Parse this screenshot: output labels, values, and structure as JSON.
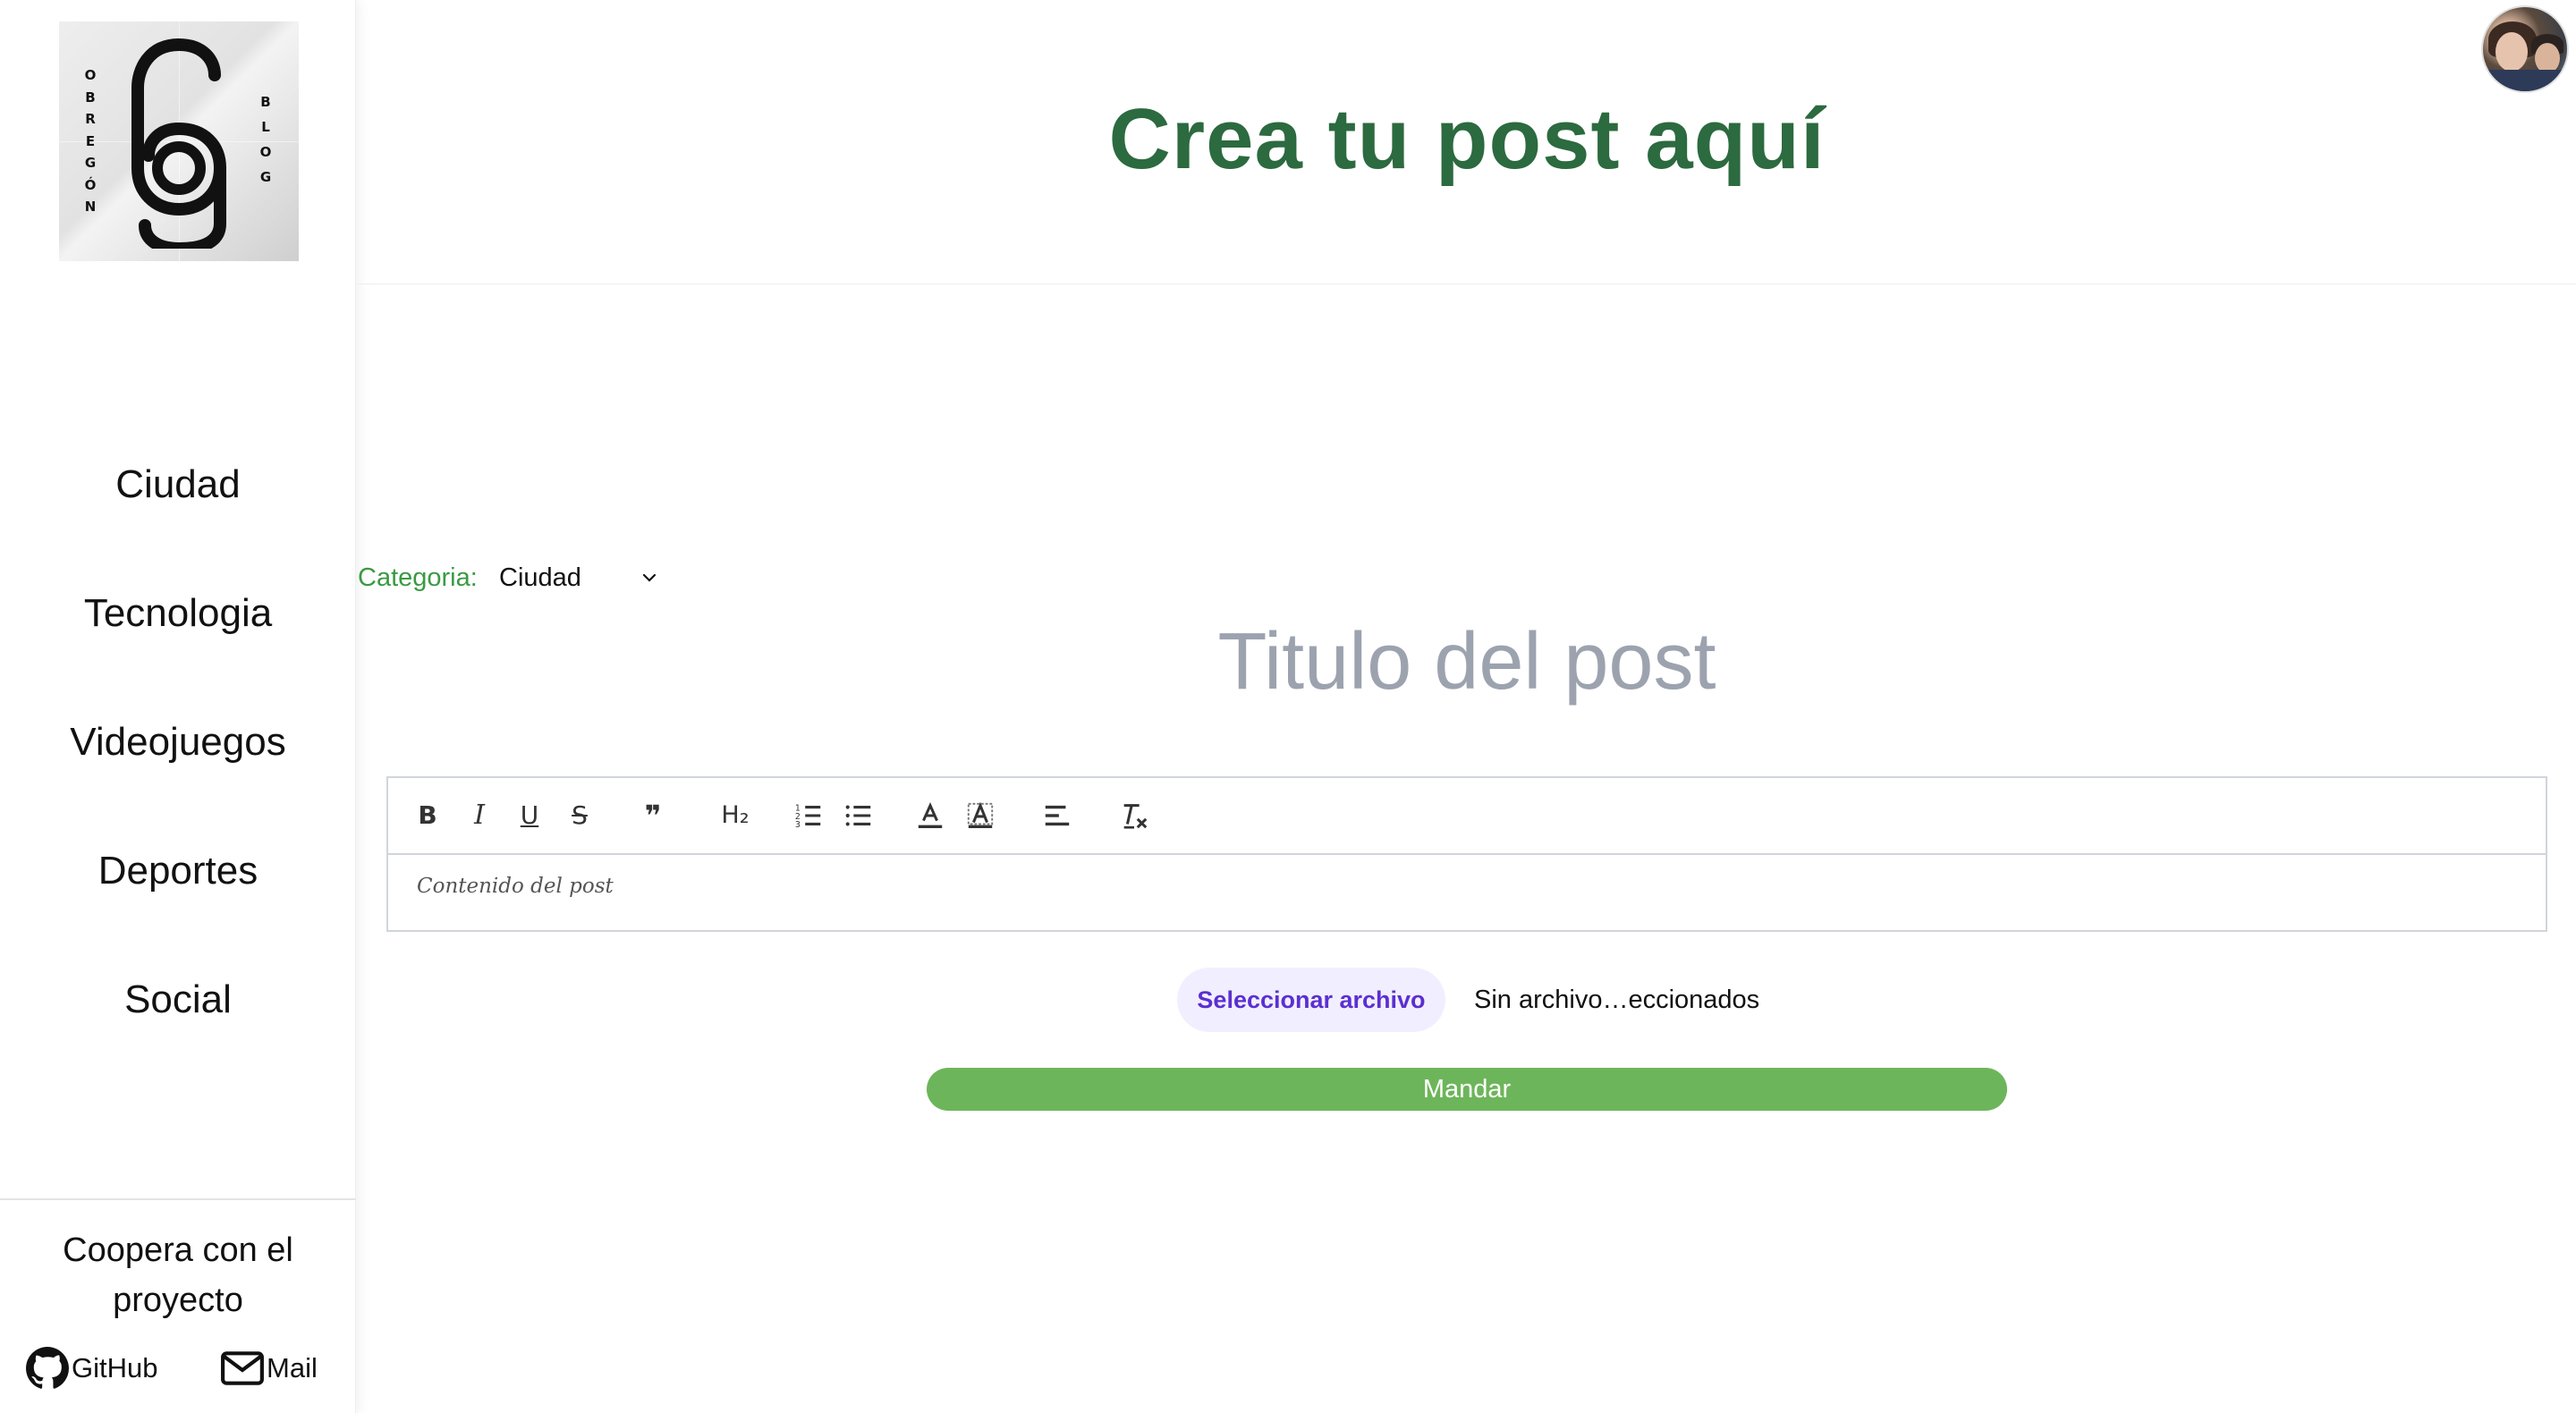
{
  "sidebar": {
    "logo": {
      "left_letters": "OBREGÓN",
      "right_letters": "BLOG"
    },
    "nav_items": [
      {
        "label": "Ciudad"
      },
      {
        "label": "Tecnologia"
      },
      {
        "label": "Videojuegos"
      },
      {
        "label": "Deportes"
      },
      {
        "label": "Social"
      }
    ],
    "cooperate_text": "Coopera con el proyecto",
    "links": [
      {
        "label": "GitHub",
        "icon": "github-icon"
      },
      {
        "label": "Mail",
        "icon": "mail-icon"
      }
    ]
  },
  "header": {
    "title": "Crea tu post aquí",
    "title_color": "#2c6a3f"
  },
  "form": {
    "category_label": "Categoria:",
    "category_value": "Ciudad",
    "title_placeholder": "Titulo del post",
    "editor": {
      "toolbar": [
        {
          "name": "bold",
          "icon": "bold-icon",
          "glyph": "B"
        },
        {
          "name": "italic",
          "icon": "italic-icon",
          "glyph": "I"
        },
        {
          "name": "underline",
          "icon": "underline-icon",
          "glyph": "U"
        },
        {
          "name": "strike",
          "icon": "strikethrough-icon",
          "glyph": "S"
        },
        {
          "name": "blockquote",
          "icon": "quote-icon",
          "glyph": "❞"
        },
        {
          "name": "header",
          "icon": "heading-2-icon",
          "glyph": "H₂"
        },
        {
          "name": "ordered-list",
          "icon": "ordered-list-icon"
        },
        {
          "name": "bullet-list",
          "icon": "bullet-list-icon"
        },
        {
          "name": "text-color",
          "icon": "text-color-icon"
        },
        {
          "name": "background-color",
          "icon": "highlight-color-icon"
        },
        {
          "name": "align",
          "icon": "align-left-icon"
        },
        {
          "name": "clean",
          "icon": "clear-format-icon"
        }
      ],
      "placeholder": "Contenido del post"
    },
    "file_button_label": "Seleccionar archivo",
    "file_status": "Sin archivo…eccionados",
    "submit_label": "Mandar"
  },
  "colors": {
    "accent_green": "#6db55a",
    "category_green": "#3a9a42",
    "file_button_text": "#5b2fd1",
    "file_button_bg": "#f1efff",
    "placeholder_gray": "#9ca3af"
  }
}
